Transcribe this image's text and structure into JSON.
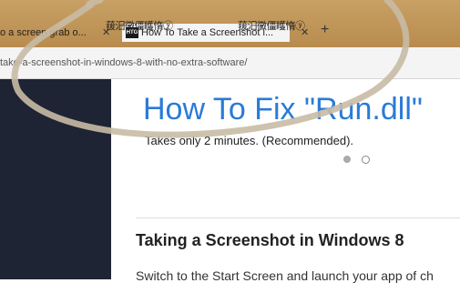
{
  "tabs": [
    {
      "label": "o a screen grab o..."
    },
    {
      "favicon": "HTG",
      "label": "How To Take a Screenshot i..."
    }
  ],
  "garbled": [
    "菝汨黴僵矆惰ⓨ",
    "菝汨黴僵矆惰ⓨ"
  ],
  "url": "take-a-screenshot-in-windows-8-with-no-extra-software/",
  "ad": {
    "title": "How To Fix \"Run.dll\"",
    "subtitle": "Takes only 2 minutes. (Recommended)."
  },
  "article": {
    "title": "Taking a Screenshot in Windows 8",
    "body": "Switch to the Start Screen and launch your app of ch"
  },
  "colors": {
    "tabbar": "#c8a065",
    "accent": "#2a7bd6",
    "sidebar": "#1e2433"
  }
}
